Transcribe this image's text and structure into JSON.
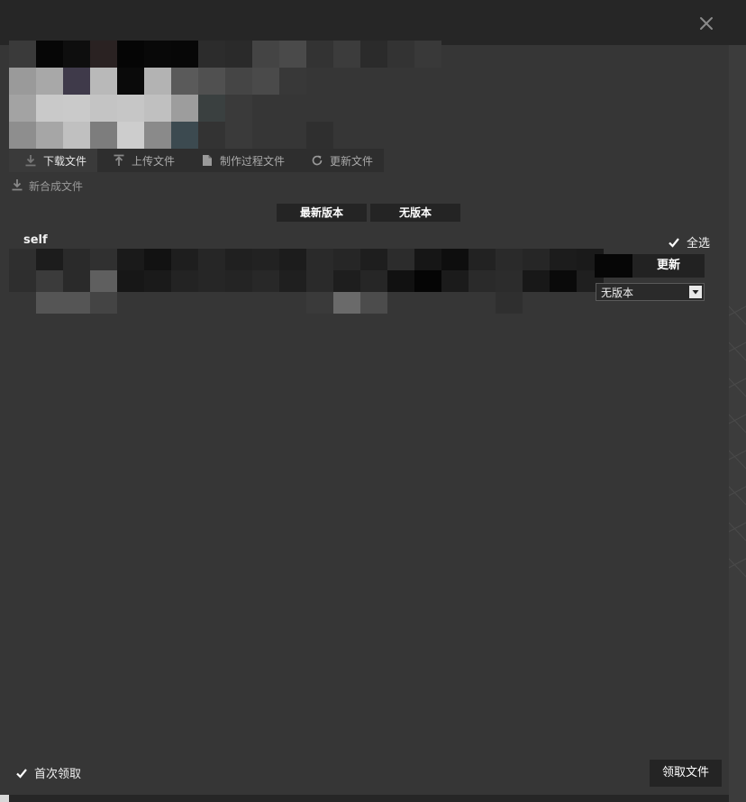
{
  "tabs": [
    {
      "label": "下载文件",
      "icon": "download-icon",
      "active": true
    },
    {
      "label": "上传文件",
      "icon": "upload-icon",
      "active": false
    },
    {
      "label": "制作过程文件",
      "icon": "document-icon",
      "active": false
    },
    {
      "label": "更新文件",
      "icon": "refresh-icon",
      "active": false
    }
  ],
  "sub_action": {
    "label": "新合成文件",
    "icon": "download-icon"
  },
  "version_buttons": {
    "latest": "最新版本",
    "none": "无版本"
  },
  "group": {
    "label": "self"
  },
  "select_all": {
    "label": "全选",
    "checked": true
  },
  "row": {
    "update_label": "更新",
    "version_selected": "无版本"
  },
  "footer": {
    "first_claim_label": "首次领取",
    "first_claim_checked": true,
    "claim_button": "领取文件"
  },
  "colors": {
    "dialog_bg": "#363636",
    "titlebar_bg": "#262626",
    "button_bg": "#242424",
    "text": "#f0f0f0"
  }
}
